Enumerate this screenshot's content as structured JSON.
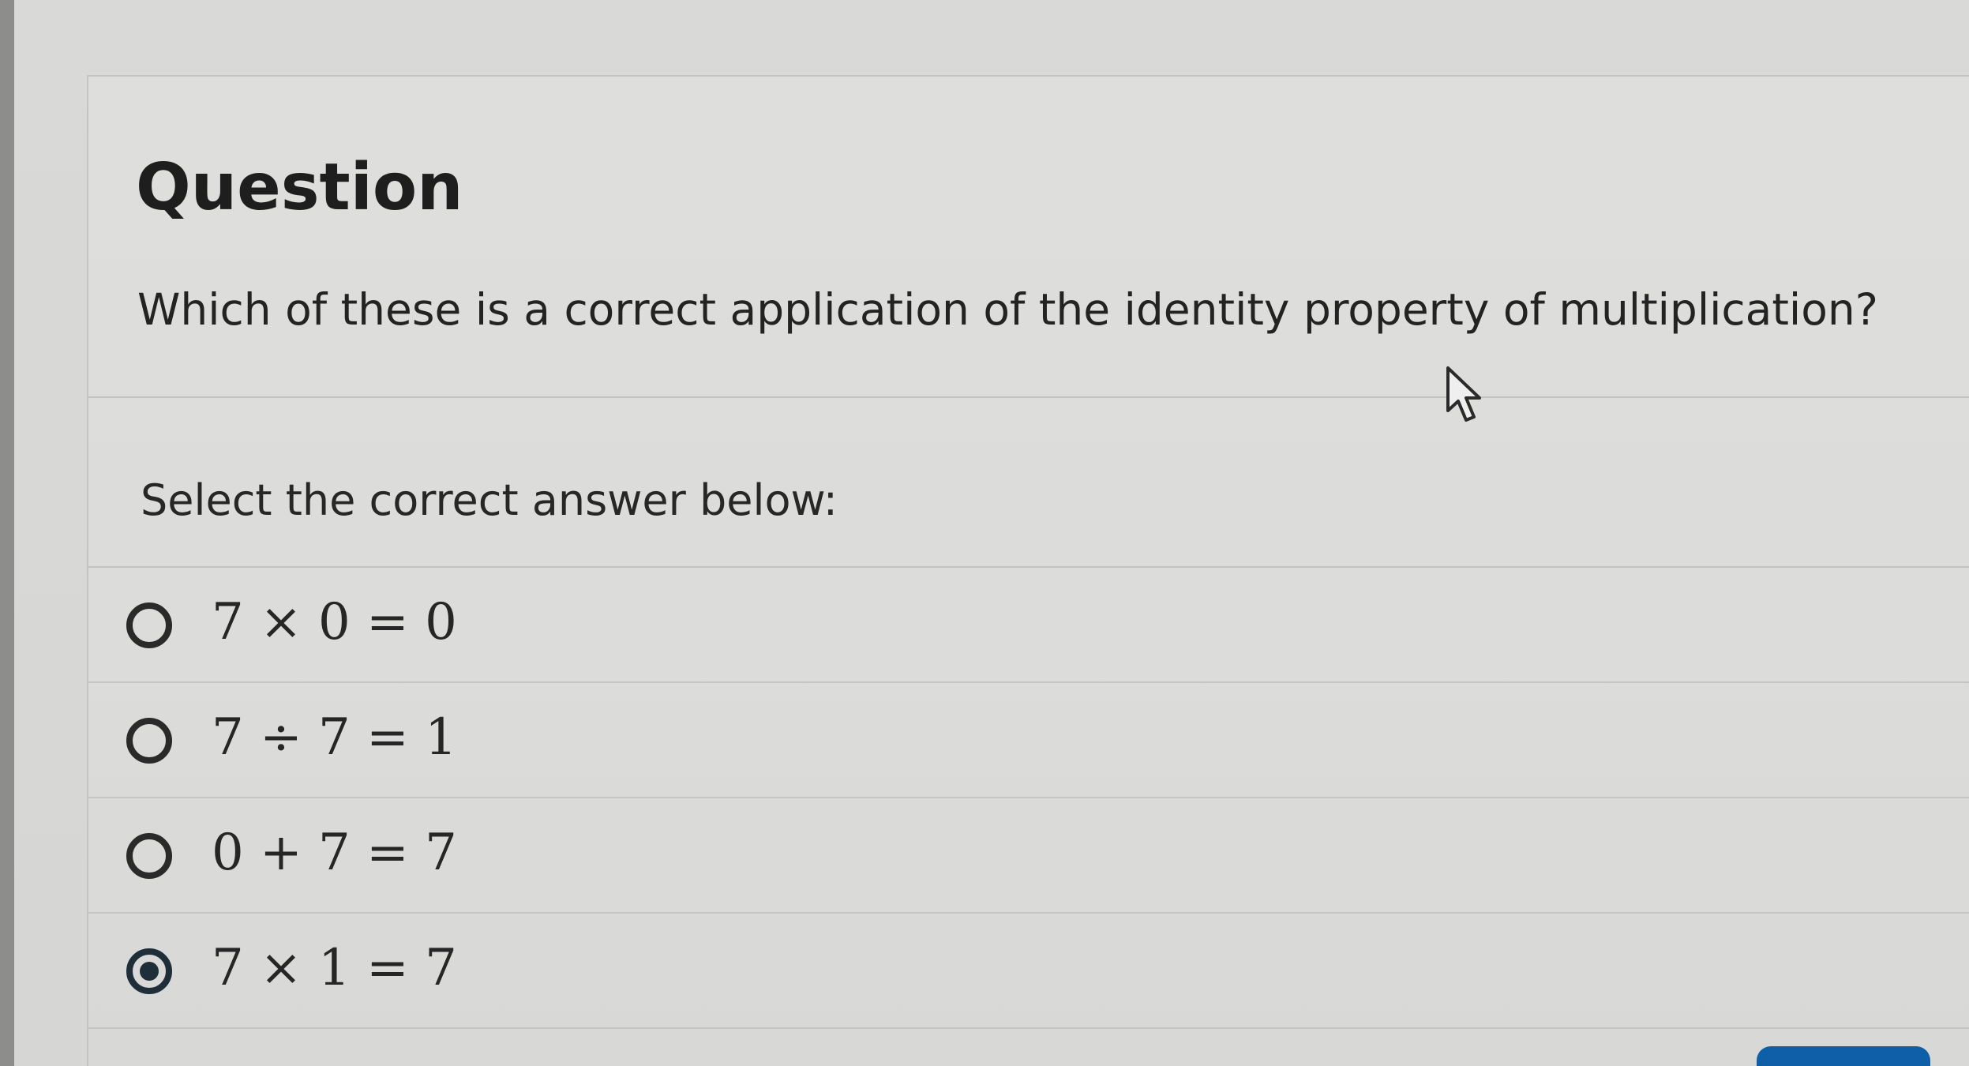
{
  "question": {
    "heading": "Question",
    "prompt": "Which of these is a correct application of the identity property of multiplication?",
    "instruction": "Select the correct answer below:"
  },
  "options": [
    {
      "label": "7 × 0 = 0",
      "selected": false
    },
    {
      "label": "7 ÷ 7 = 1",
      "selected": false
    },
    {
      "label": "0 + 7 = 7",
      "selected": false
    },
    {
      "label": "7 × 1 = 7",
      "selected": true
    }
  ],
  "colors": {
    "accent": "#0f5fa8",
    "selected_radio": "#1f2f3a"
  },
  "icons": {
    "cursor": "arrow-cursor-icon",
    "radio": "radio-button-icon"
  }
}
